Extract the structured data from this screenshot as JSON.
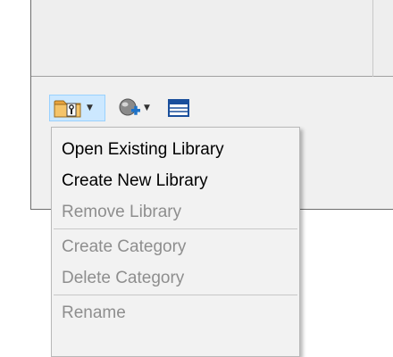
{
  "toolbar": {
    "buttons": [
      {
        "icon": "library-folder-icon",
        "has_dropdown": true,
        "state": "pressed"
      },
      {
        "icon": "add-globe-icon",
        "has_dropdown": true
      },
      {
        "icon": "list-view-icon",
        "has_dropdown": false
      }
    ]
  },
  "menu": {
    "items": [
      {
        "label": "Open Existing Library",
        "enabled": true
      },
      {
        "label": "Create New Library",
        "enabled": true
      },
      {
        "label": "Remove Library",
        "enabled": false
      },
      {
        "label": "Create Category",
        "enabled": false
      },
      {
        "label": "Delete Category",
        "enabled": false
      },
      {
        "label": "Rename",
        "enabled": false
      }
    ]
  },
  "colors": {
    "pressed_bg": "#cce8ff",
    "pressed_border": "#99d1ff",
    "disabled_text": "#8e8e8e",
    "menu_bg": "#f2f2f2"
  }
}
